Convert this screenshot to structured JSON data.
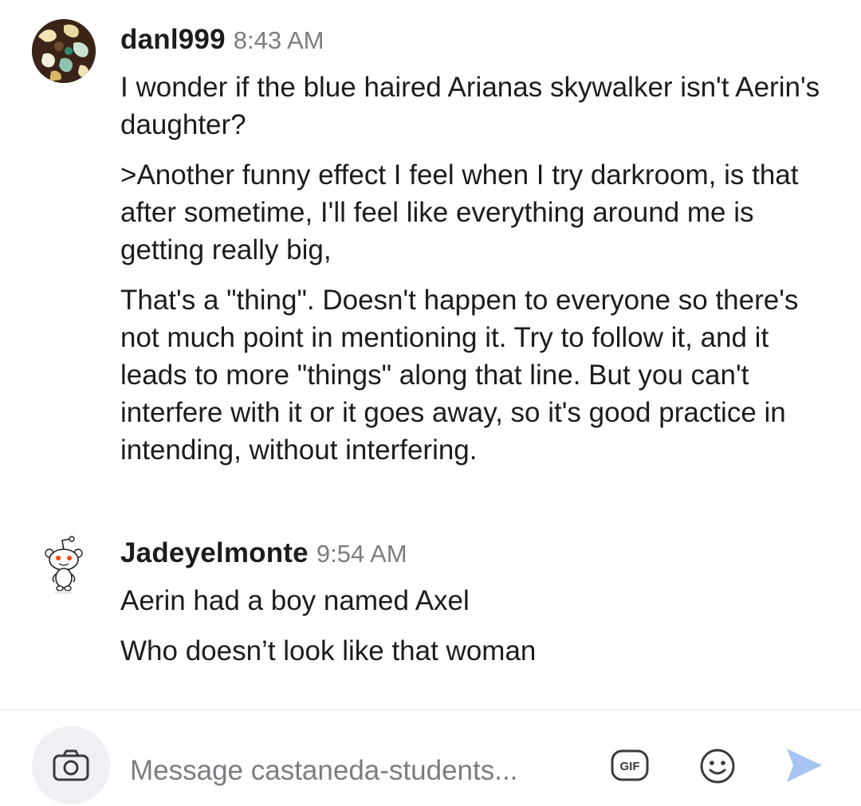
{
  "messages": [
    {
      "username": "danl999",
      "time": "8:43 AM",
      "avatar_icon": "user-photo-avatar",
      "paragraphs": [
        "I wonder if the blue haired Arianas skywalker isn't Aerin's daughter?",
        ">Another funny effect I feel when I try darkroom, is that after sometime, I'll feel like everything around me is getting really big,",
        "That's a \"thing\". Doesn't happen to everyone so there's not much point in mentioning it.  Try to follow it, and it leads to more \"things\" along  that line. But you can't interfere with it or it goes away, so it's good practice in intending, without interfering."
      ]
    },
    {
      "username": "Jadeyelmonte",
      "time": "9:54 AM",
      "avatar_icon": "snoo-avatar",
      "paragraphs": [
        "Aerin had a boy named Axel",
        "Who doesn’t look like that woman"
      ]
    }
  ],
  "composer": {
    "placeholder": "Message castaneda-students...",
    "camera_icon": "camera-icon",
    "gif_icon": "gif-icon",
    "gif_label": "GIF",
    "emoji_icon": "emoji-icon",
    "send_icon": "send-icon"
  },
  "colors": {
    "text": "#1c1c1e",
    "muted": "#7c7c83",
    "send": "#a7c4f2",
    "divider": "#e3e3e6",
    "camera_bg": "#eef0f3",
    "snoo_accent": "#ff4500"
  }
}
